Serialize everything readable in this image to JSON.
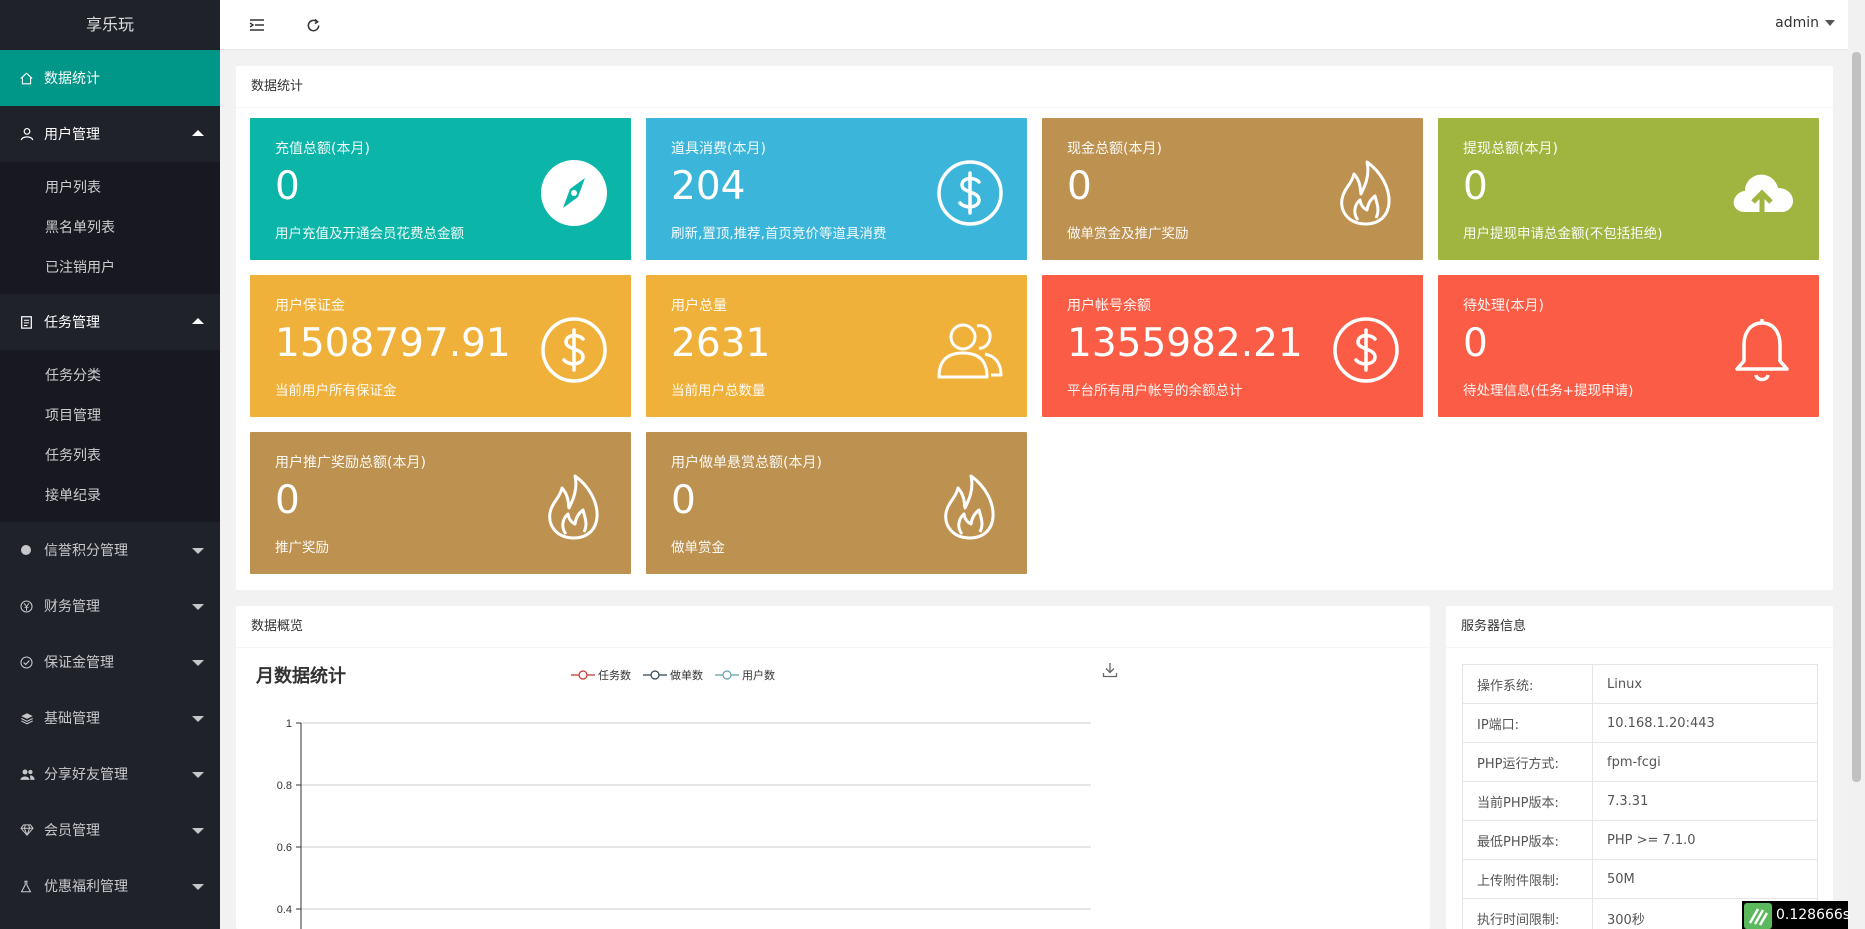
{
  "app": {
    "title": "享乐玩",
    "user": "admin"
  },
  "sidebar": {
    "items": [
      {
        "label": "数据统计",
        "icon": "home-icon"
      },
      {
        "label": "用户管理",
        "icon": "user-icon",
        "sub": [
          "用户列表",
          "黑名单列表",
          "已注销用户"
        ]
      },
      {
        "label": "任务管理",
        "icon": "clipboard-icon",
        "sub": [
          "任务分类",
          "项目管理",
          "任务列表",
          "接单纪录"
        ]
      },
      {
        "label": "信誉积分管理",
        "icon": "circle-icon"
      },
      {
        "label": "财务管理",
        "icon": "yen-icon"
      },
      {
        "label": "保证金管理",
        "icon": "check-circle-icon"
      },
      {
        "label": "基础管理",
        "icon": "layers-icon"
      },
      {
        "label": "分享好友管理",
        "icon": "users-icon"
      },
      {
        "label": "会员管理",
        "icon": "diamond-icon"
      },
      {
        "label": "优惠福利管理",
        "icon": "flask-icon"
      }
    ]
  },
  "stats": {
    "title": "数据统计",
    "tiles": [
      {
        "title": "充值总额(本月)",
        "value": "0",
        "desc": "用户充值及开通会员花费总金额",
        "color": "#0bb5a8",
        "icon": "compass-icon"
      },
      {
        "title": "道具消费(本月)",
        "value": "204",
        "desc": "刷新,置顶,推荐,首页竞价等道具消费",
        "color": "#3bb5d9",
        "icon": "dollar-icon"
      },
      {
        "title": "现金总额(本月)",
        "value": "0",
        "desc": "做单赏金及推广奖励",
        "color": "#bd9150",
        "icon": "fire-icon"
      },
      {
        "title": "提现总额(本月)",
        "value": "0",
        "desc": "用户提现申请总金额(不包括拒绝)",
        "color": "#a0b540",
        "icon": "cloud-upload-icon"
      },
      {
        "title": "用户保证金",
        "value": "1508797.91",
        "desc": "当前用户所有保证金",
        "color": "#f0b13b",
        "icon": "dollar-icon"
      },
      {
        "title": "用户总量",
        "value": "2631",
        "desc": "当前用户总数量",
        "color": "#f0b13b",
        "icon": "users-icon"
      },
      {
        "title": "用户帐号余额",
        "value": "1355982.21",
        "desc": "平台所有用户帐号的余额总计",
        "color": "#fb5c45",
        "icon": "dollar-icon"
      },
      {
        "title": "待处理(本月)",
        "value": "0",
        "desc": "待处理信息(任务+提现申请)",
        "color": "#fb5c45",
        "icon": "bell-icon"
      },
      {
        "title": "用户推广奖励总额(本月)",
        "value": "0",
        "desc": "推广奖励",
        "color": "#bd9150",
        "icon": "fire-icon"
      },
      {
        "title": "用户做单悬赏总额(本月)",
        "value": "0",
        "desc": "做单赏金",
        "color": "#bd9150",
        "icon": "fire-icon"
      }
    ]
  },
  "overview": {
    "title": "数据概览"
  },
  "chart_data": {
    "type": "line",
    "title": "月数据统计",
    "series": [
      {
        "name": "任务数",
        "color": "#c23531",
        "values": []
      },
      {
        "name": "做单数",
        "color": "#2f4554",
        "values": []
      },
      {
        "name": "用户数",
        "color": "#61a0a8",
        "values": []
      }
    ],
    "yticks": [
      "1",
      "0.8",
      "0.6",
      "0.4"
    ],
    "ylim": [
      0,
      1
    ]
  },
  "server": {
    "title": "服务器信息",
    "rows": [
      {
        "k": "操作系统:",
        "v": "Linux"
      },
      {
        "k": "IP端口:",
        "v": "10.168.1.20:443"
      },
      {
        "k": "PHP运行方式:",
        "v": "fpm-fcgi"
      },
      {
        "k": "当前PHP版本:",
        "v": "7.3.31"
      },
      {
        "k": "最低PHP版本:",
        "v": "PHP >= 7.1.0"
      },
      {
        "k": "上传附件限制:",
        "v": "50M"
      },
      {
        "k": "执行时间限制:",
        "v": "300秒"
      }
    ]
  },
  "timer": "0.128666s"
}
